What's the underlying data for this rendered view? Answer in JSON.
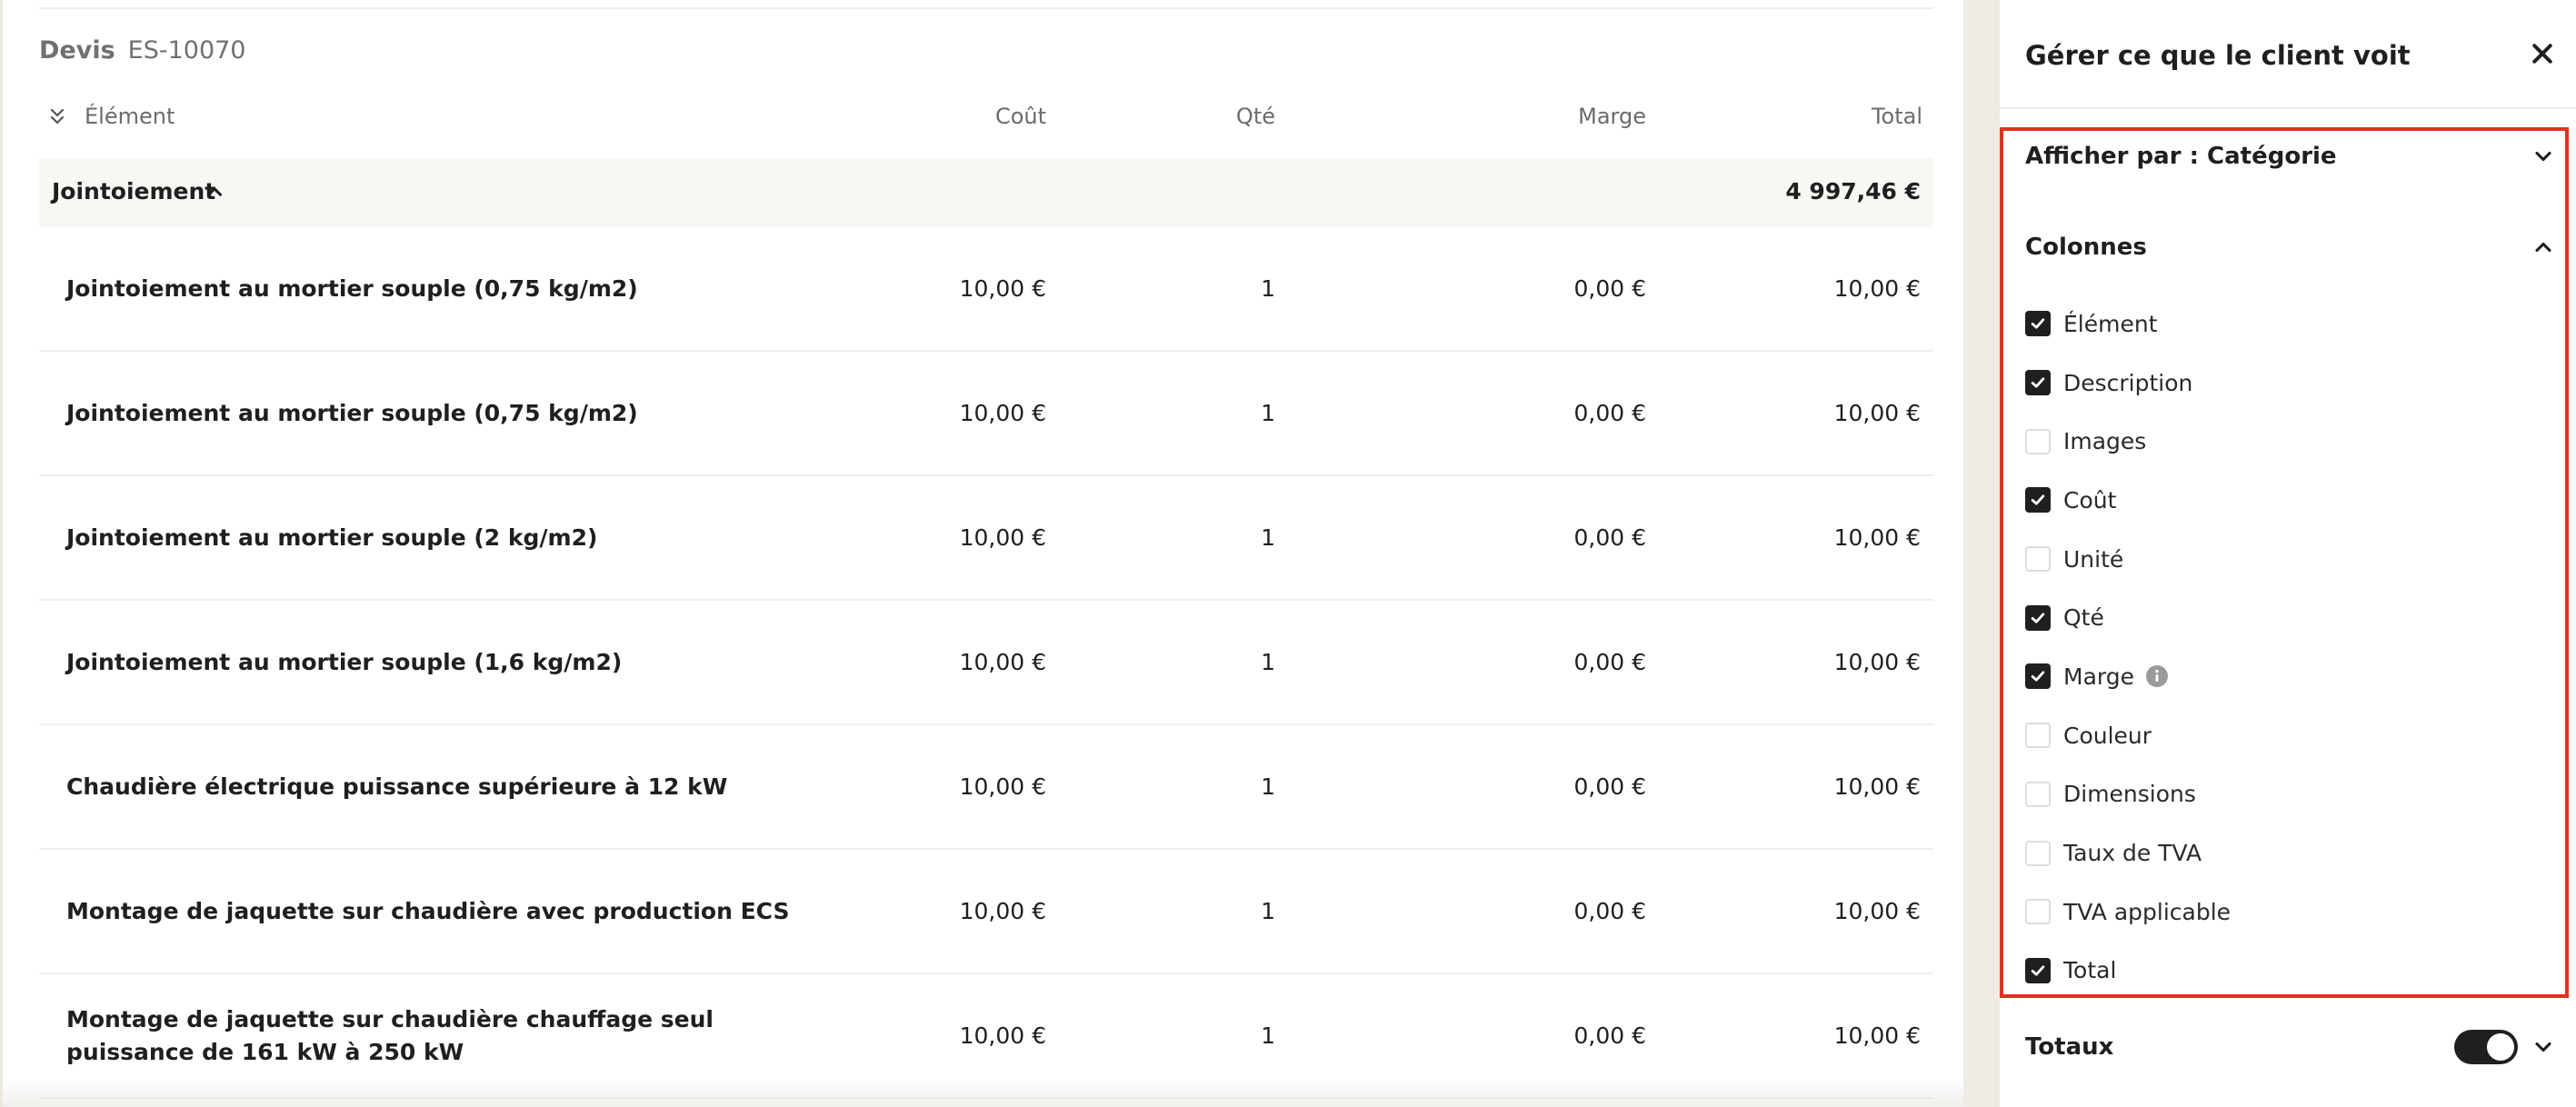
{
  "quote": {
    "label": "Devis",
    "number": "ES-10070"
  },
  "table": {
    "headers": {
      "element": "Élément",
      "cout": "Coût",
      "qte": "Qté",
      "marge": "Marge",
      "total": "Total"
    },
    "category": {
      "name": "Jointoiement",
      "total": "4 997,46 €"
    },
    "rows": [
      {
        "element": "Jointoiement au mortier souple (0,75 kg/m2)",
        "cout": "10,00 €",
        "qte": "1",
        "marge": "0,00 €",
        "total": "10,00 €"
      },
      {
        "element": "Jointoiement au mortier souple (0,75 kg/m2)",
        "cout": "10,00 €",
        "qte": "1",
        "marge": "0,00 €",
        "total": "10,00 €"
      },
      {
        "element": "Jointoiement au mortier souple (2 kg/m2)",
        "cout": "10,00 €",
        "qte": "1",
        "marge": "0,00 €",
        "total": "10,00 €"
      },
      {
        "element": "Jointoiement au mortier souple (1,6 kg/m2)",
        "cout": "10,00 €",
        "qte": "1",
        "marge": "0,00 €",
        "total": "10,00 €"
      },
      {
        "element": "Chaudière électrique puissance supérieure à 12 kW",
        "cout": "10,00 €",
        "qte": "1",
        "marge": "0,00 €",
        "total": "10,00 €"
      },
      {
        "element": "Montage de jaquette sur chaudière avec production ECS",
        "cout": "10,00 €",
        "qte": "1",
        "marge": "0,00 €",
        "total": "10,00 €"
      },
      {
        "element": "Montage de jaquette sur chaudière chauffage seul puissance de 161 kW à 250 kW",
        "cout": "10,00 €",
        "qte": "1",
        "marge": "0,00 €",
        "total": "10,00 €"
      }
    ]
  },
  "panel": {
    "title": "Gérer ce que le client voit",
    "close_icon": "close-icon",
    "display_by": "Afficher par : Catégorie",
    "columns_title": "Colonnes",
    "columns": [
      {
        "label": "Élément",
        "checked": true
      },
      {
        "label": "Description",
        "checked": true
      },
      {
        "label": "Images",
        "checked": false
      },
      {
        "label": "Coût",
        "checked": true
      },
      {
        "label": "Unité",
        "checked": false
      },
      {
        "label": "Qté",
        "checked": true
      },
      {
        "label": "Marge",
        "checked": true,
        "info": true
      },
      {
        "label": "Couleur",
        "checked": false
      },
      {
        "label": "Dimensions",
        "checked": false
      },
      {
        "label": "Taux de TVA",
        "checked": false
      },
      {
        "label": "TVA applicable",
        "checked": false
      },
      {
        "label": "Total",
        "checked": true
      }
    ],
    "totaux_label": "Totaux",
    "totaux_enabled": true
  },
  "colors": {
    "highlight_border": "#e0321c",
    "checkbox_checked": "#1f1f1f",
    "toggle_on": "#1f1f1f"
  }
}
